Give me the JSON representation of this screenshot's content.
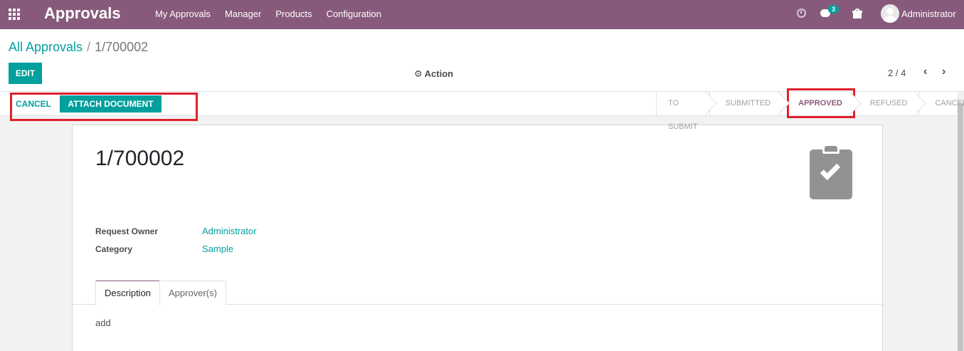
{
  "navbar": {
    "app_title": "Approvals",
    "menu": [
      "My Approvals",
      "Manager",
      "Products",
      "Configuration"
    ],
    "chat_badge": "3",
    "user_name": "Administrator",
    "bg_color": "#875a7b"
  },
  "control_panel": {
    "breadcrumb_parent": "All Approvals",
    "breadcrumb_separator": "/",
    "breadcrumb_current": "1/700002",
    "edit_label": "EDIT",
    "action_label": "Action",
    "pager_value": "2 / 4",
    "accent_color": "#00a09d"
  },
  "statusbar": {
    "cancel_label": "CANCEL",
    "attach_label": "ATTACH DOCUMENT",
    "stages": [
      "TO SUBMIT",
      "SUBMITTED",
      "APPROVED",
      "REFUSED",
      "CANCEL"
    ],
    "active_stage": "APPROVED"
  },
  "form": {
    "record_name": "1/700002",
    "request_owner_label": "Request Owner",
    "request_owner_value": "Administrator",
    "category_label": "Category",
    "category_value": "Sample",
    "tabs": [
      "Description",
      "Approver(s)"
    ],
    "active_tab": "Description",
    "description_text": "add"
  }
}
